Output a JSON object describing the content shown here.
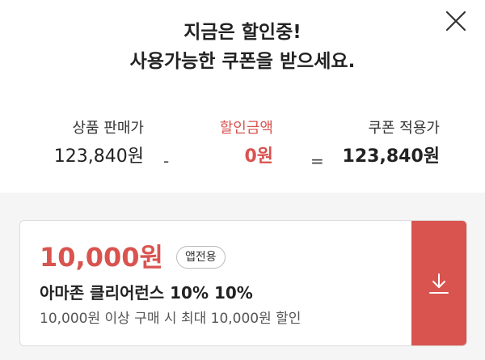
{
  "header": {
    "title_line1": "지금은 할인중!",
    "title_line2": "사용가능한 쿠폰을 받으세요.",
    "close_icon": "close-icon"
  },
  "summary": {
    "original": {
      "label": "상품 판매가",
      "value": "123,840원"
    },
    "minus": "-",
    "discount": {
      "label": "할인금액",
      "value": "0원"
    },
    "equal": "=",
    "final": {
      "label": "쿠폰 적용가",
      "value": "123,840원"
    }
  },
  "coupon": {
    "amount": "10,000원",
    "badge": "앱전용",
    "name": "아마존 클리어런스 10% 10%",
    "description": "10,000원 이상 구매 시 최대 10,000원 할인",
    "download_icon": "download-icon"
  },
  "colors": {
    "accent": "#d9534f",
    "background_area": "#f5f5f5",
    "text": "#222222"
  }
}
